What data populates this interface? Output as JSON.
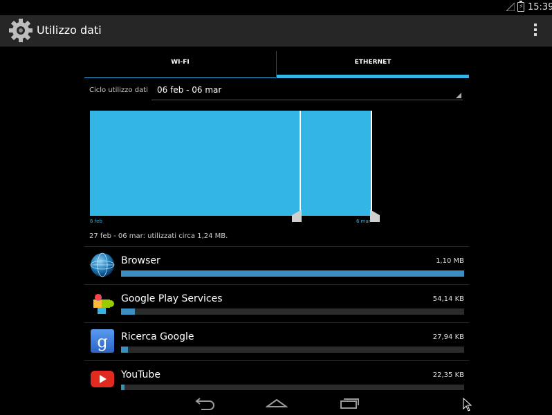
{
  "status": {
    "time": "15:39"
  },
  "actionbar": {
    "title": "Utilizzo dati"
  },
  "tabs": [
    {
      "label": "WI-FI",
      "selected": false
    },
    {
      "label": "ETHERNET",
      "selected": true
    }
  ],
  "cycle": {
    "label": "Ciclo utilizzo dati",
    "value": "06 feb - 06 mar"
  },
  "chart_data": {
    "ticks": [
      "6 feb",
      "6 mar"
    ]
  },
  "summary": "27 feb - 06 mar: utilizzati circa 1,24 MB.",
  "apps": [
    {
      "name": "Browser",
      "amount": "1,10 MB",
      "fraction": 1.0,
      "icon": "browser-icon"
    },
    {
      "name": "Google Play Services",
      "amount": "54,14 KB",
      "fraction": 0.04,
      "icon": "google-play-services-icon"
    },
    {
      "name": "Ricerca Google",
      "amount": "27,94 KB",
      "fraction": 0.02,
      "icon": "google-search-icon"
    },
    {
      "name": "YouTube",
      "amount": "22,35 KB",
      "fraction": 0.01,
      "icon": "youtube-icon"
    }
  ],
  "colors": {
    "accent": "#33b5e5",
    "bar": "#3a8fc0",
    "actionbar": "#262626"
  }
}
